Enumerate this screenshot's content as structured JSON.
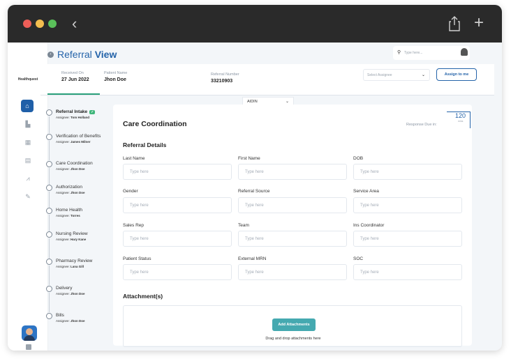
{
  "app": {
    "title_normal": "Referral ",
    "title_bold": "View",
    "brand": "Healthquest"
  },
  "search": {
    "placeholder": "Type here..."
  },
  "info": {
    "received_label": "Received On",
    "received_value": "27 Jun 2022",
    "patient_label": "Patient Name",
    "patient_value": "Jhon Doe",
    "referral_label": "Referral Number",
    "referral_value": "33210903",
    "assignee_placeholder": "Select Assignee",
    "assign_button": "Assign to me"
  },
  "aidin": {
    "value": "AIDIN"
  },
  "steps": [
    {
      "name": "Referral Intake",
      "badge": "✓",
      "assignee_label": "Assignee:",
      "assignee": "Tom Holland"
    },
    {
      "name": "Verification of Benefits",
      "assignee_label": "Assignee:",
      "assignee": "James Milner"
    },
    {
      "name": "Care Coordination",
      "assignee_label": "Assignee:",
      "assignee": "Jhon Doe"
    },
    {
      "name": "Authorization",
      "assignee_label": "Assignee:",
      "assignee": "Jhon Doe"
    },
    {
      "name": "Home Health",
      "assignee_label": "Assignee:",
      "assignee": "Torres"
    },
    {
      "name": "Nursing Review",
      "assignee_label": "Assignee:",
      "assignee": "Hary Kane"
    },
    {
      "name": "Pharmacy Review",
      "assignee_label": "Assignee:",
      "assignee": "Lana Gill"
    },
    {
      "name": "Delivery",
      "assignee_label": "Assignee:",
      "assignee": "Jhon Doe"
    },
    {
      "name": "Bills",
      "assignee_label": "Assignee:",
      "assignee": "Jhon Doe"
    }
  ],
  "panel": {
    "title": "Care Coordination",
    "response_label": "Response Due in:",
    "timer_value": "120",
    "timer_unit": "mins",
    "details_title": "Referral Details",
    "fields": [
      {
        "label": "Last Name",
        "placeholder": "Type here"
      },
      {
        "label": "First Name",
        "placeholder": "Type here"
      },
      {
        "label": "DOB",
        "placeholder": "Type here"
      },
      {
        "label": "Gender",
        "placeholder": "Type here"
      },
      {
        "label": "Referral Source",
        "placeholder": "Type here"
      },
      {
        "label": "Service Area",
        "placeholder": "Type here"
      },
      {
        "label": "Sales Rep",
        "placeholder": "Type here"
      },
      {
        "label": "Team",
        "placeholder": "Type here"
      },
      {
        "label": "Ins Coordinator",
        "placeholder": "Type here"
      },
      {
        "label": "Patient Status",
        "placeholder": "Type here"
      },
      {
        "label": "External MRN",
        "placeholder": "Type here"
      },
      {
        "label": "SOC",
        "placeholder": "Type here"
      }
    ],
    "attachments_title": "Attachment(s)",
    "add_attachments": "Add Attachments",
    "drop_text": "Drag and drop attachments here"
  },
  "colors": {
    "accent": "#2463a9",
    "success": "#3fb67b",
    "teal": "#45a9b0"
  }
}
